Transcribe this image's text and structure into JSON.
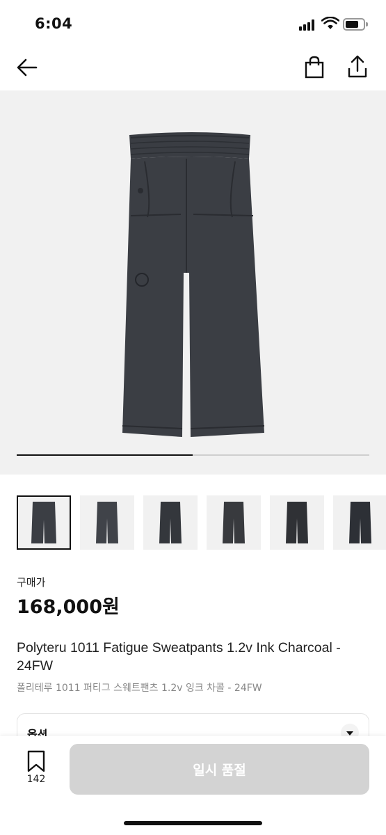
{
  "status_bar": {
    "time": "6:04"
  },
  "header": {
    "back_icon": "back-arrow-icon",
    "cart_icon": "shopping-bag-icon",
    "share_icon": "share-icon"
  },
  "hero": {
    "image": "charcoal sweatpants product photo",
    "slide_progress": 0.5
  },
  "thumbnails": [
    {
      "selected": true
    },
    {
      "selected": false
    },
    {
      "selected": false
    },
    {
      "selected": false
    },
    {
      "selected": false
    },
    {
      "selected": false
    }
  ],
  "product": {
    "price_label": "구매가",
    "price": "168,000원",
    "title_en": "Polyteru 1011 Fatigue Sweatpants 1.2v Ink Charcoal - 24FW",
    "title_ko": "폴리테루 1011 퍼티그 스웨트팬츠 1.2v 잉크 차콜 - 24FW"
  },
  "options": {
    "label": "옵션"
  },
  "bottom_bar": {
    "wish_count": "142",
    "soldout_label": "일시 품절"
  },
  "colors": {
    "accent": "#111111",
    "disabled_button": "#d3d3d3",
    "image_bg": "#f1f1f1"
  }
}
